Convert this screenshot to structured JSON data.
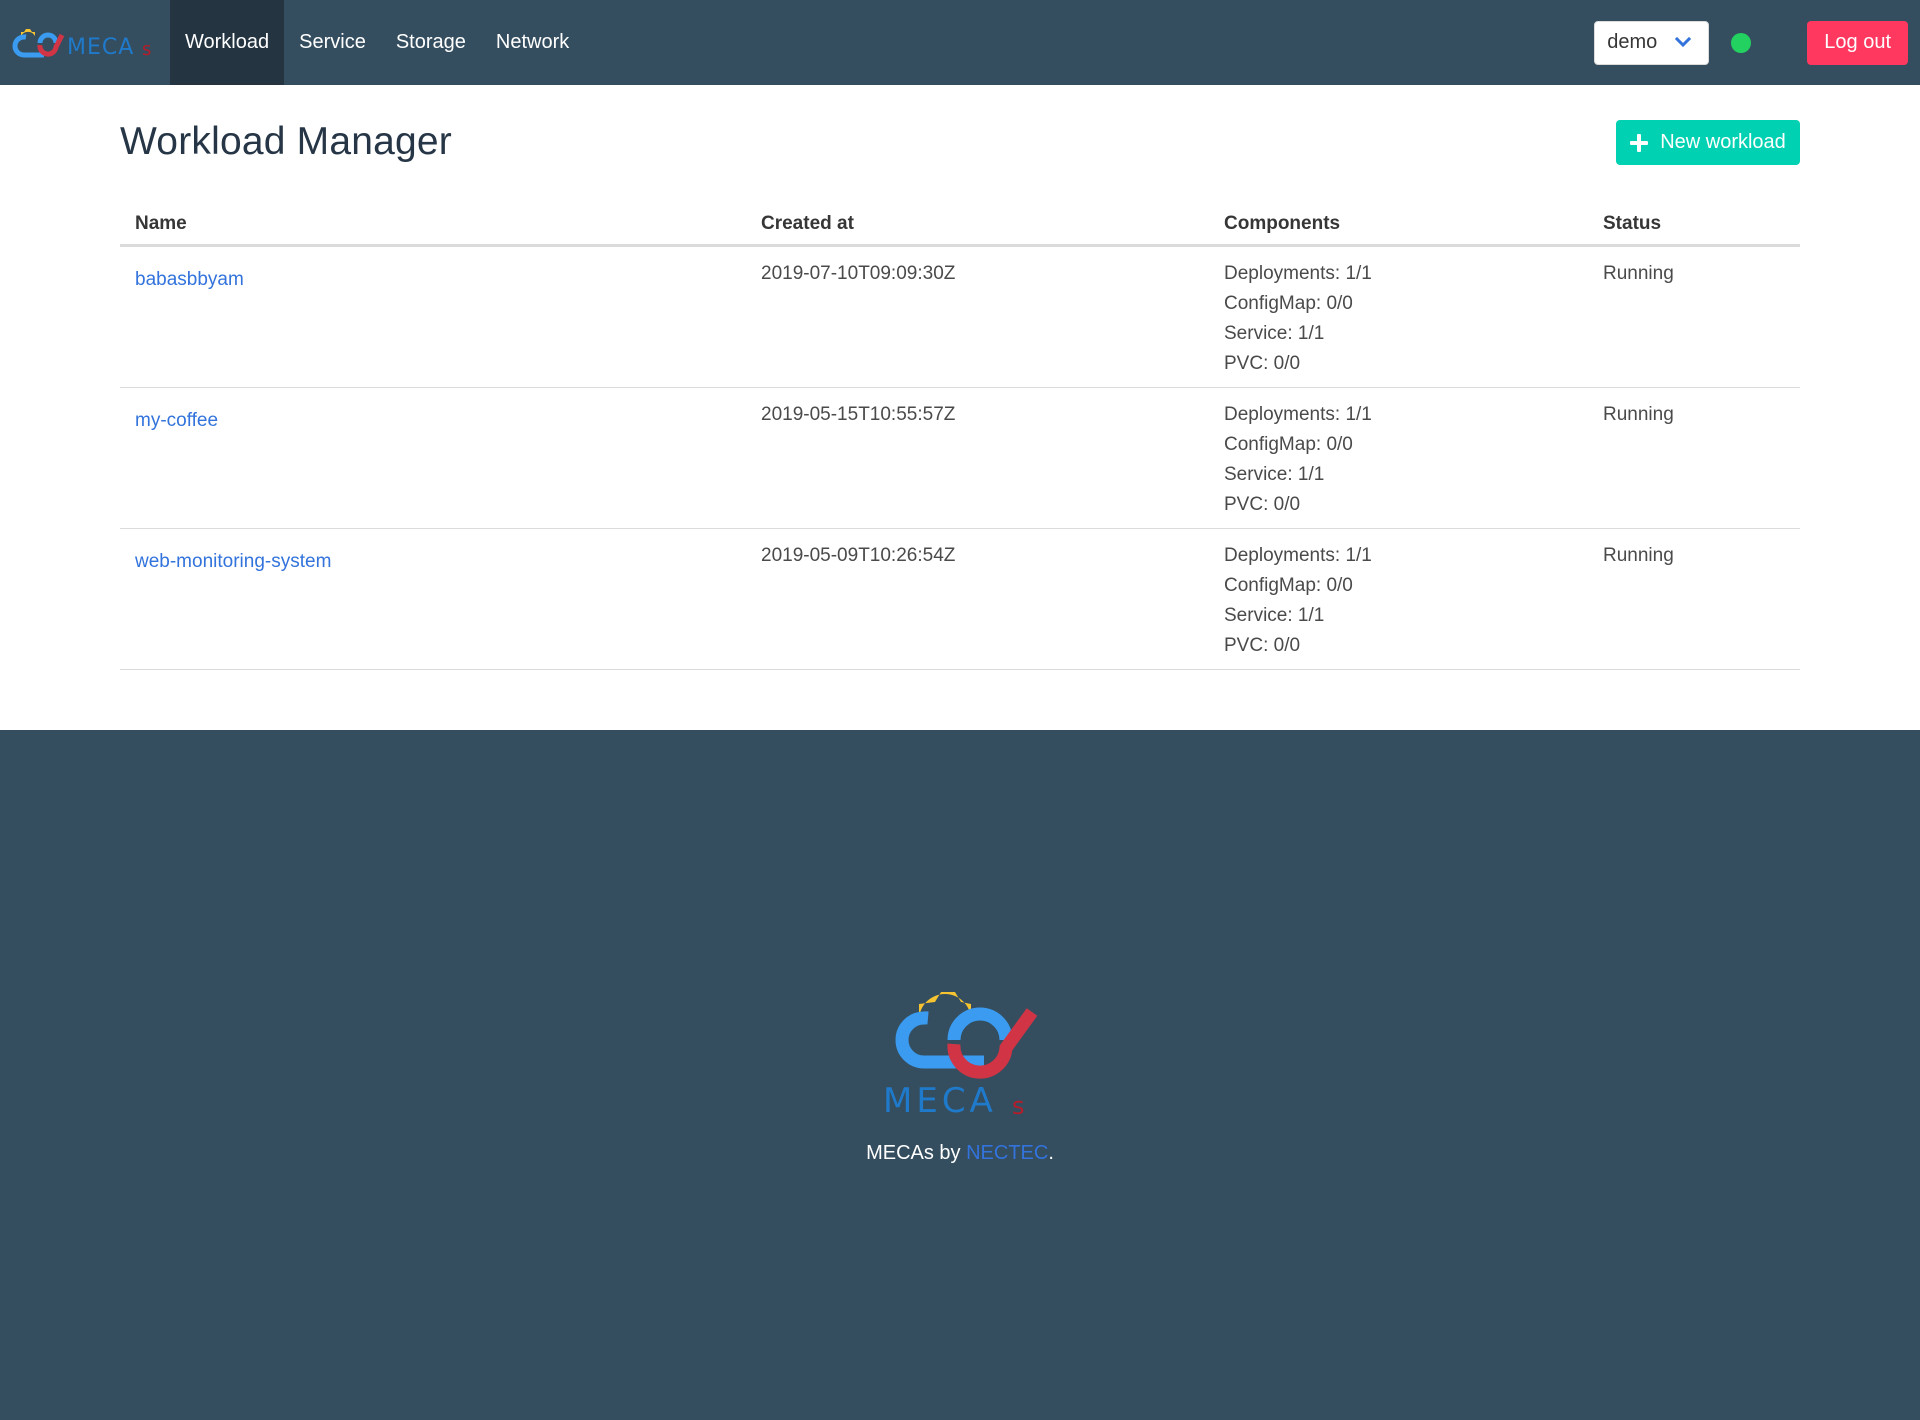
{
  "navbar": {
    "brand": "MECAs",
    "items": [
      {
        "label": "Workload",
        "active": true
      },
      {
        "label": "Service",
        "active": false
      },
      {
        "label": "Storage",
        "active": false
      },
      {
        "label": "Network",
        "active": false
      }
    ],
    "namespace_select": {
      "value": "demo",
      "icon": "chevron-down-icon"
    },
    "status_indicator": {
      "color": "#23d160",
      "state": "online"
    },
    "logout_label": "Log out"
  },
  "main": {
    "title": "Workload Manager",
    "new_button": {
      "label": "New workload",
      "icon": "plus-icon"
    },
    "table": {
      "headers": [
        "Name",
        "Created at",
        "Components",
        "Status"
      ],
      "rows": [
        {
          "name": "babasbbyam",
          "created_at": "2019-07-10T09:09:30Z",
          "components": [
            "Deployments: 1/1",
            "ConfigMap: 0/0",
            "Service: 1/1",
            "PVC: 0/0"
          ],
          "status": "Running"
        },
        {
          "name": "my-coffee",
          "created_at": "2019-05-15T10:55:57Z",
          "components": [
            "Deployments: 1/1",
            "ConfigMap: 0/0",
            "Service: 1/1",
            "PVC: 0/0"
          ],
          "status": "Running"
        },
        {
          "name": "web-monitoring-system",
          "created_at": "2019-05-09T10:26:54Z",
          "components": [
            "Deployments: 1/1",
            "ConfigMap: 0/0",
            "Service: 1/1",
            "PVC: 0/0"
          ],
          "status": "Running"
        }
      ]
    }
  },
  "footer": {
    "logo_text": "MECAs",
    "text_prefix": "MECAs by ",
    "link": "NECTEC",
    "text_suffix": "."
  },
  "colors": {
    "navbar_bg": "#344e5f",
    "nav_active_bg": "#243441",
    "primary_teal": "#00d1b2",
    "danger": "#ff3860",
    "link": "#3273dc",
    "success": "#23d160"
  }
}
